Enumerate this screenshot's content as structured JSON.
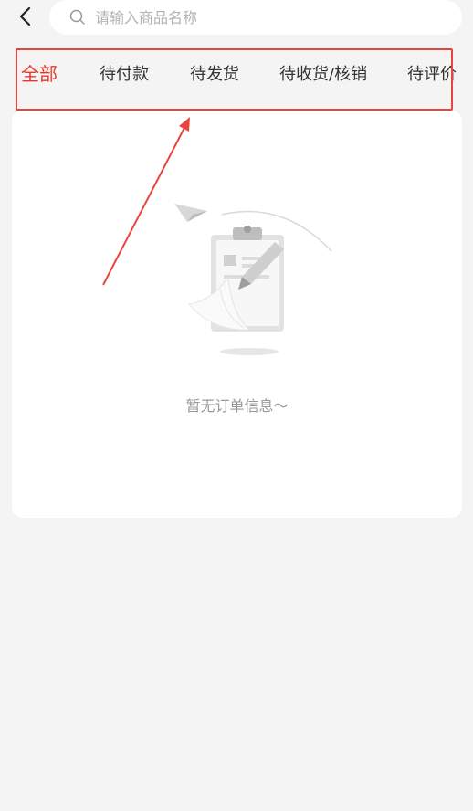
{
  "header": {
    "search_placeholder": "请输入商品名称",
    "back_icon": "chevron-left-icon",
    "search_icon": "search-icon"
  },
  "tabs": [
    {
      "label": "全部",
      "active": true
    },
    {
      "label": "待付款",
      "active": false
    },
    {
      "label": "待发货",
      "active": false
    },
    {
      "label": "待收货/核销",
      "active": false
    },
    {
      "label": "待评价",
      "active": false
    }
  ],
  "empty_state": {
    "icon": "clipboard-empty-icon",
    "message": "暂无订单信息～"
  },
  "colors": {
    "accent": "#e8372d",
    "annotation": "#e8463c",
    "background": "#f4f4f4"
  }
}
